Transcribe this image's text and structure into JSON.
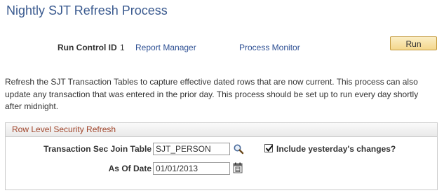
{
  "page": {
    "title": "Nightly SJT Refresh Process"
  },
  "run_control": {
    "label": "Run Control ID",
    "value": "1",
    "report_manager_link": "Report Manager",
    "process_monitor_link": "Process Monitor",
    "run_button": "Run"
  },
  "description": "Refresh the SJT Transaction Tables to capture effective dated rows that are now current. This process can also update any transaction that was entered in the prior day. This process should be set up to run every day shortly after midnight.",
  "group": {
    "title": "Row Level Security Refresh",
    "transaction_label": "Transaction Sec Join Table",
    "transaction_value": "SJT_PERSON",
    "include_label": "Include yesterday's changes?",
    "include_checked": true,
    "as_of_label": "As Of Date",
    "as_of_value": "01/01/2013"
  },
  "icons": {
    "lookup": "magnifying-glass-lookup-icon",
    "calendar": "calendar-icon",
    "checkbox": "checkmark-icon"
  },
  "colors": {
    "title": "#3a5a8f",
    "link": "#2d4f93",
    "group_title": "#a0442a",
    "run_button_bg": "#f4d78c"
  }
}
